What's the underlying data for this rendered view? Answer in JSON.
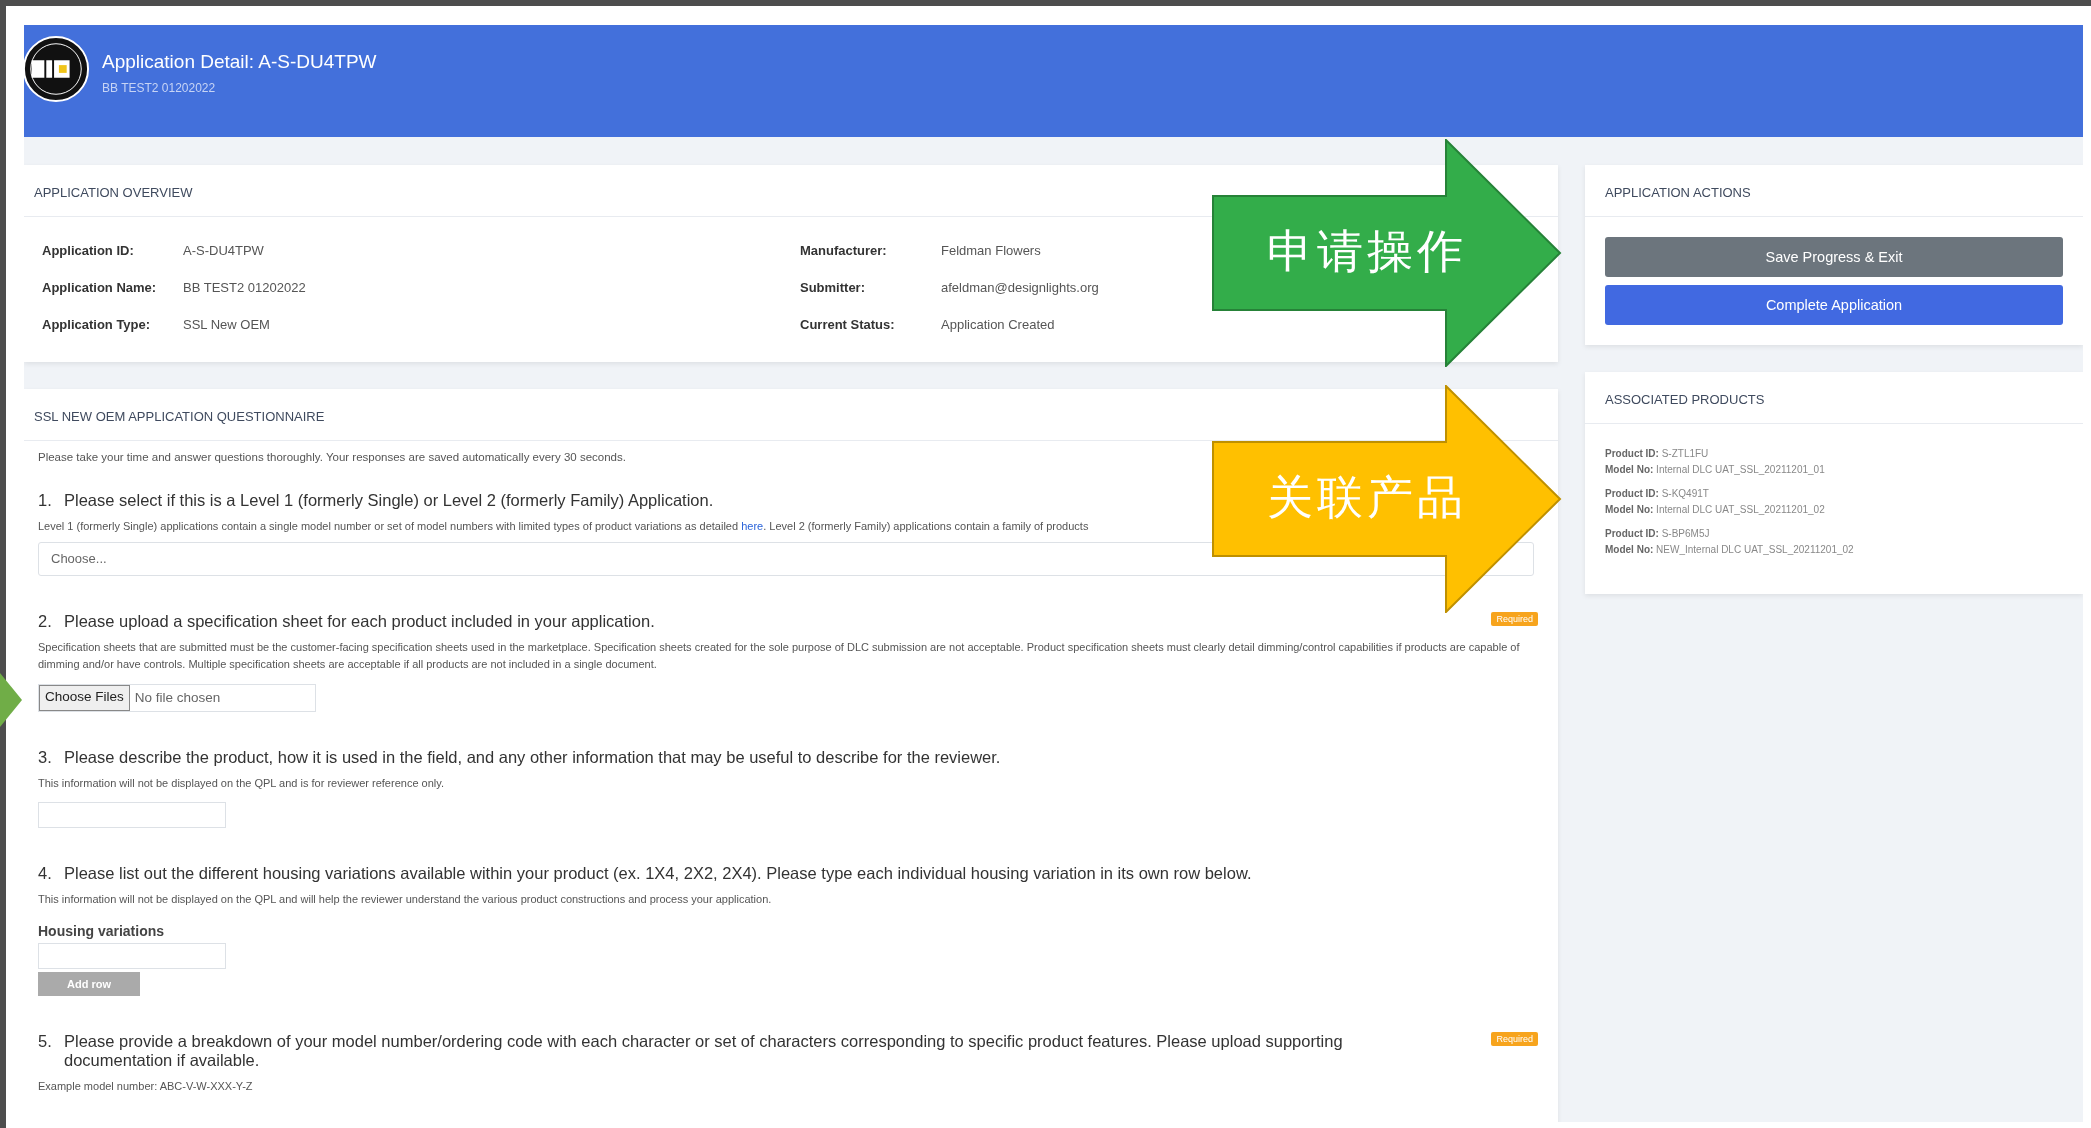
{
  "header": {
    "title": "Application Detail: A-S-DU4TPW",
    "subtitle": "BB TEST2 01202022"
  },
  "overview": {
    "title": "APPLICATION OVERVIEW",
    "columns": [
      [
        {
          "label": "Application ID:",
          "value": "A-S-DU4TPW"
        },
        {
          "label": "Application Name:",
          "value": "BB TEST2 01202022"
        },
        {
          "label": "Application Type:",
          "value": "SSL New OEM"
        }
      ],
      [
        {
          "label": "Manufacturer:",
          "value": "Feldman Flowers"
        },
        {
          "label": "Submitter:",
          "value": "afeldman@designlights.org"
        },
        {
          "label": "Current Status:",
          "value": "Application Created"
        }
      ]
    ]
  },
  "questionnaire": {
    "title": "SSL NEW OEM APPLICATION QUESTIONNAIRE",
    "intro": "Please take your time and answer questions thoroughly. Your responses are saved automatically every 30 seconds.",
    "questions": [
      {
        "number": "1.",
        "text": "Please select if this is a Level 1 (formerly Single) or Level 2 (formerly Family) Application.",
        "note": "Level 1 (formerly Single) applications contain a single model number or set of model numbers with limited types of product variations as detailed",
        "link": "here",
        "note_after": ". Level 2 (formerly Family) applications contain a family of products",
        "kind": "select",
        "placeholder": "Choose..."
      },
      {
        "number": "2.",
        "text": "Please upload a specification sheet for each product included in your application.",
        "badge": "Required",
        "note": "Specification sheets that are submitted must be the customer-facing specification sheets used in the marketplace. Specification sheets created for the sole purpose of DLC submission are not acceptable. Product specification sheets must clearly detail dimming/control capabilities if products are capable of dimming and/or have controls. Multiple specification sheets are acceptable if all products are not included in a single document.",
        "kind": "file",
        "button": "Choose Files",
        "status": "No file chosen"
      },
      {
        "number": "3.",
        "text": "Please describe the product, how it is used in the field, and any other information that may be useful to describe for the reviewer.",
        "note": "This information will not be displayed on the QPL and is for reviewer reference only.",
        "kind": "text"
      },
      {
        "number": "4.",
        "text": "Please list out the different housing variations available within your product (ex. 1X4, 2X2, 2X4). Please type each individual housing variation in its own row below.",
        "note": "This information will not be displayed on the QPL and will help the reviewer understand the various product constructions and process your application.",
        "kind": "rows",
        "label": "Housing variations",
        "button": "Add row"
      },
      {
        "number": "5.",
        "text": "Please provide a breakdown of your model number/ordering code with each character or set of characters corresponding to specific product features. Please upload supporting documentation if available.",
        "badge": "Required",
        "note": "Example model number: ABC-V-W-XXX-Y-Z",
        "kind": "none"
      }
    ]
  },
  "actions": {
    "title": "APPLICATION ACTIONS",
    "buttons": [
      {
        "label": "Save Progress & Exit",
        "kind": "secondary"
      },
      {
        "label": "Complete Application",
        "kind": "primary"
      }
    ]
  },
  "products": {
    "title": "ASSOCIATED PRODUCTS",
    "items": [
      {
        "id_label": "Product ID:",
        "id": "S-ZTL1FU",
        "model_label": "Model No:",
        "model": "Internal DLC UAT_SSL_20211201_01"
      },
      {
        "id_label": "Product ID:",
        "id": "S-KQ491T",
        "model_label": "Model No:",
        "model": "Internal DLC UAT_SSL_20211201_02"
      },
      {
        "id_label": "Product ID:",
        "id": "S-BP6M5J",
        "model_label": "Model No:",
        "model": "NEW_Internal DLC UAT_SSL_20211201_02"
      }
    ]
  },
  "callouts": [
    {
      "text": "申请操作",
      "color": "#33ad4a"
    },
    {
      "text": "关联产品",
      "color": "#ffc000"
    }
  ]
}
